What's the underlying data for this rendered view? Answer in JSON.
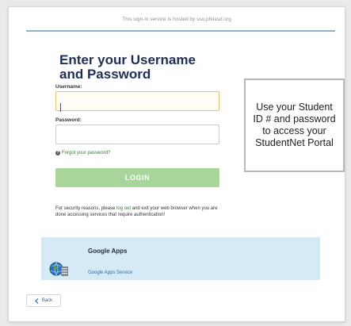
{
  "header": {
    "hosted_text": "This sign-in service is hosted by sso.philasd.org"
  },
  "login_form": {
    "title_line1": "Enter your Username",
    "title_line2": "and Password",
    "username_label": "Username:",
    "username_value": "",
    "password_label": "Password:",
    "password_value": "",
    "forgot_link": "Forgot your password?",
    "login_button": "LOGIN",
    "security_pre": "For security reasons, please ",
    "security_link": "log out",
    "security_post": " and exit your web browser when you are done accessing services that require authentication!"
  },
  "google_apps": {
    "title": "Google Apps",
    "subtitle": "Google Apps Service",
    "icon": "globe-server-icon"
  },
  "back_button": {
    "label": "Back",
    "icon": "chevron-left-icon"
  },
  "callout": {
    "text": "Use your Student ID # and password to access your StudentNet Portal"
  },
  "colors": {
    "title": "#1e2f57",
    "login_button": "#a7d59a",
    "link_green": "#2d7d3b",
    "apps_bg": "#d6eaf5",
    "focused_border": "#e3c073"
  }
}
